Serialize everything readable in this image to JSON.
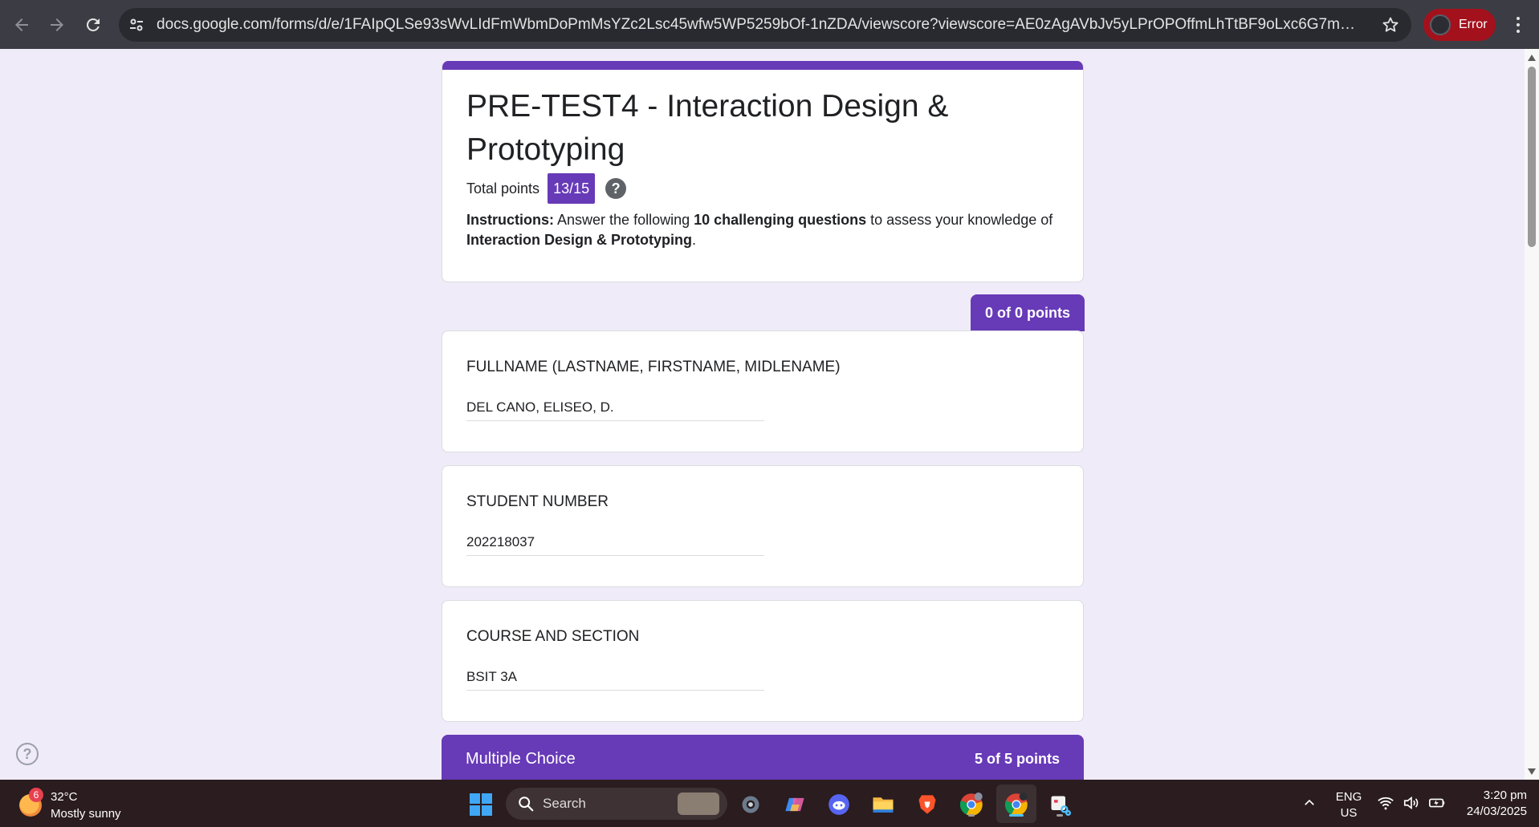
{
  "browser": {
    "url": "docs.google.com/forms/d/e/1FAIpQLSe93sWvLIdFmWbmDoPmMsYZc2Lsc45wfw5WP5259bOf-1nZDA/viewscore?viewscore=AE0zAgAVbJv5yLPrOPOffmLhTtBF9oLxc6G7ma_1ipuH8e6YNurgauV...",
    "profile_status": "Error"
  },
  "form": {
    "title": "PRE-TEST4 - Interaction Design & Prototyping",
    "total_points_label": "Total points",
    "score": "13/15",
    "help_mark": "?",
    "instructions": {
      "label": "Instructions:",
      "text1": " Answer the following ",
      "bold1": "10 challenging questions",
      "text2": " to assess your knowledge of ",
      "bold2": "Interaction Design & Prototyping",
      "text3": "."
    },
    "section_points": "0 of 0 points",
    "questions": [
      {
        "label": "FULLNAME (LASTNAME, FIRSTNAME, MIDLENAME)",
        "answer": "DEL CANO, ELISEO, D."
      },
      {
        "label": "STUDENT NUMBER",
        "answer": "202218037"
      },
      {
        "label": "COURSE AND SECTION",
        "answer": "BSIT 3A"
      }
    ],
    "multiple_choice": {
      "title": "Multiple Choice",
      "points": "5 of 5 points"
    }
  },
  "page_help_mark": "?",
  "taskbar": {
    "weather": {
      "badge": "6",
      "temp": "32°C",
      "desc": "Mostly sunny"
    },
    "search_label": "Search",
    "language": {
      "line1": "ENG",
      "line2": "US"
    },
    "clock": {
      "time": "3:20 pm",
      "date": "24/03/2025"
    }
  },
  "colors": {
    "accent": "#673ab7",
    "page_bg": "#f0ebf8",
    "browser_bar": "#3c3d44",
    "error_chip": "#a3111c",
    "taskbar": "#2a1c1f"
  }
}
